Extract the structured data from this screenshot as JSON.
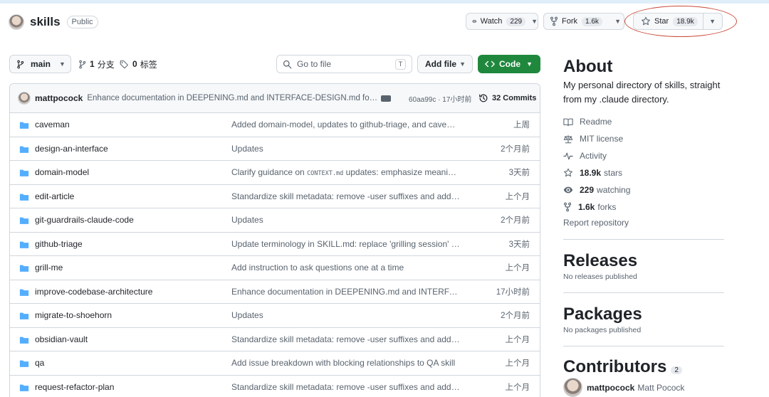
{
  "repo": {
    "name": "skills",
    "visibility": "Public"
  },
  "header_buttons": {
    "watch_label": "Watch",
    "watch_count": "229",
    "fork_label": "Fork",
    "fork_count": "1.6k",
    "star_label": "Star",
    "star_count": "18.9k"
  },
  "toolbar": {
    "branch": "main",
    "branches_count": "1",
    "branches_label": "分支",
    "tags_count": "0",
    "tags_label": "标签",
    "goto_placeholder": "Go to file",
    "goto_shortcut": "T",
    "add_file_label": "Add file",
    "code_label": "Code"
  },
  "latest_commit": {
    "author": "mattpocock",
    "message": "Enhance documentation in DEEPENING.md and INTERFACE-DESIGN.md for cla...",
    "hash_time": "60aa99c · 17小时前",
    "commits_label": "32 Commits"
  },
  "files": [
    {
      "name": "caveman",
      "message": "Added domain-model, updates to github-triage, and caveman",
      "time": "上周"
    },
    {
      "name": "design-an-interface",
      "message": "Updates",
      "time": "2个月前"
    },
    {
      "name": "domain-model",
      "message_pre": "Clarify guidance on ",
      "message_code": "CONTEXT.md",
      "message_post": " updates: emphasize meaningf...",
      "time": "3天前"
    },
    {
      "name": "edit-article",
      "message": "Standardize skill metadata: remove -user suffixes and add mi...",
      "time": "上个月"
    },
    {
      "name": "git-guardrails-claude-code",
      "message": "Updates",
      "time": "2个月前"
    },
    {
      "name": "github-triage",
      "message": "Update terminology in SKILL.md: replace 'grilling session' wit...",
      "time": "3天前"
    },
    {
      "name": "grill-me",
      "message": "Add instruction to ask questions one at a time",
      "time": "上个月"
    },
    {
      "name": "improve-codebase-architecture",
      "message": "Enhance documentation in DEEPENING.md and INTERFACE-D...",
      "time": "17小时前"
    },
    {
      "name": "migrate-to-shoehorn",
      "message": "Updates",
      "time": "2个月前"
    },
    {
      "name": "obsidian-vault",
      "message": "Standardize skill metadata: remove -user suffixes and add mi...",
      "time": "上个月"
    },
    {
      "name": "qa",
      "message": "Add issue breakdown with blocking relationships to QA skill",
      "time": "上个月"
    },
    {
      "name": "request-refactor-plan",
      "message": "Standardize skill metadata: remove -user suffixes and add mi...",
      "time": "上个月"
    }
  ],
  "about": {
    "heading": "About",
    "description": "My personal directory of skills, straight from my .claude directory.",
    "readme": "Readme",
    "license": "MIT license",
    "activity": "Activity",
    "stars_count": "18.9k",
    "stars_label": "stars",
    "watching_count": "229",
    "watching_label": "watching",
    "forks_count": "1.6k",
    "forks_label": "forks",
    "report": "Report repository"
  },
  "releases": {
    "heading": "Releases",
    "empty": "No releases published"
  },
  "packages": {
    "heading": "Packages",
    "empty": "No packages published"
  },
  "contributors": {
    "heading": "Contributors",
    "count": "2",
    "first_login": "mattpocock",
    "first_name": "Matt Pocock"
  },
  "colors": {
    "accent_green": "#1f883d",
    "annotation_red": "#c94a3a",
    "link_blue": "#0969da",
    "folder_blue": "#54aeff"
  }
}
